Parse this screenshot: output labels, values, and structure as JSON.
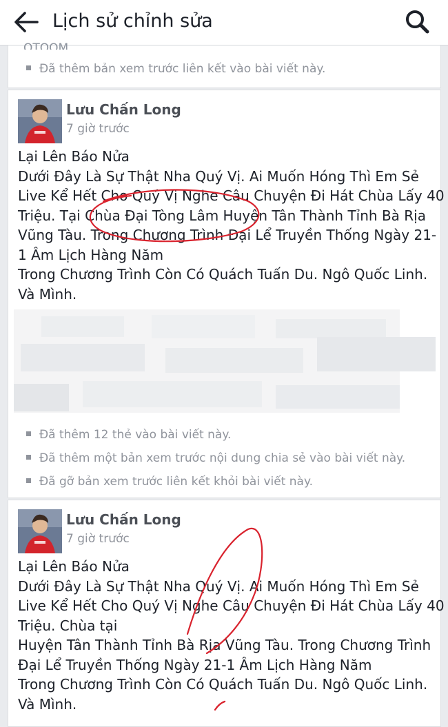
{
  "header": {
    "title": "Lịch sử chỉnh sửa",
    "back_icon": "arrow-left-icon",
    "search_icon": "search-icon"
  },
  "top_partial": {
    "cut_text": "QTQOM",
    "note": "Đã thêm bản xem trước liên kết vào bài viết này."
  },
  "revisions": [
    {
      "author": "Lưu Chấn Long",
      "time": "7 giờ trước",
      "lines": [
        "Lại Lên Báo Nửa",
        "Dưới Đây Là Sự Thật Nha Quý Vị. Ai Muốn Hóng Thì Em Sẻ",
        "Live Kể Hết Cho Quý Vị Nghe Câu Chuyện Đi Hát Chùa Lấy 40",
        "Triệu. Tại Chùa Đại Tòng Lâm Huyện Tân Thành Tỉnh Bà Rịa",
        "Vũng Tàu. Trong Chương Trình Đại Lể Truyền Thống Ngày 21-",
        "1 Âm Lịch Hàng Năm",
        "Trong Chương Trình Còn Có Quách Tuấn Du. Ngô Quốc Linh.",
        "Và Mình."
      ],
      "notes": [
        "Đã thêm 12 thẻ vào bài viết này.",
        "Đã thêm một bản xem trước nội dung chia sẻ vào bài viết này.",
        "Đã gỡ bản xem trước liên kết khỏi bài viết này."
      ]
    },
    {
      "author": "Lưu Chấn Long",
      "time": "7 giờ trước",
      "lines": [
        "Lại Lên Báo Nửa",
        "Dưới Đây Là Sự Thật Nha Quý Vị. Ai Muốn Hóng Thì Em Sẻ",
        "Live Kể Hết Cho Quý Vị Nghe Câu Chuyện Đi Hát Chùa Lấy 40",
        "Triệu. Chùa tại",
        "Huyện Tân Thành Tỉnh Bà Rịa Vũng Tàu. Trong Chương Trình",
        "Đại Lể Truyền Thống Ngày 21-1 Âm Lịch Hàng Năm",
        "Trong Chương Trình Còn Có Quách Tuấn Du. Ngô Quốc Linh.",
        "Và Mình."
      ]
    }
  ],
  "colors": {
    "background": "#e9ebee",
    "card": "#ffffff",
    "author": "#4b4f56",
    "meta": "#90949c",
    "annotation_red": "#d9232e"
  }
}
